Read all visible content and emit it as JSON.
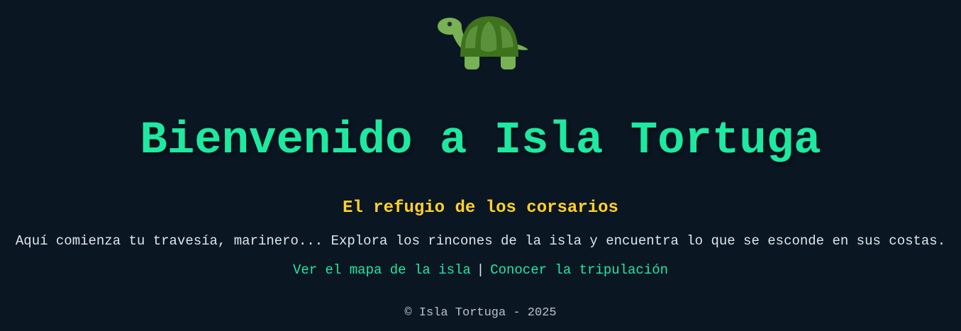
{
  "header": {
    "logo_icon": "turtle-icon",
    "title": "Bienvenido a Isla Tortuga"
  },
  "main": {
    "subtitle": "El refugio de los corsarios",
    "intro": "Aquí comienza tu travesía, marinero... Explora los rincones de la isla y encuentra lo que se esconde en sus costas.",
    "links": {
      "map": "Ver el mapa de la isla",
      "separator": "|",
      "crew": "Conocer la tripulación"
    }
  },
  "footer": {
    "text": "© Isla Tortuga - 2025"
  },
  "colors": {
    "background": "#0b1623",
    "accent": "#1de9a0",
    "subtitle": "#ffd12a",
    "text": "#dfe6ea",
    "footer_text": "#b9c0c6"
  }
}
